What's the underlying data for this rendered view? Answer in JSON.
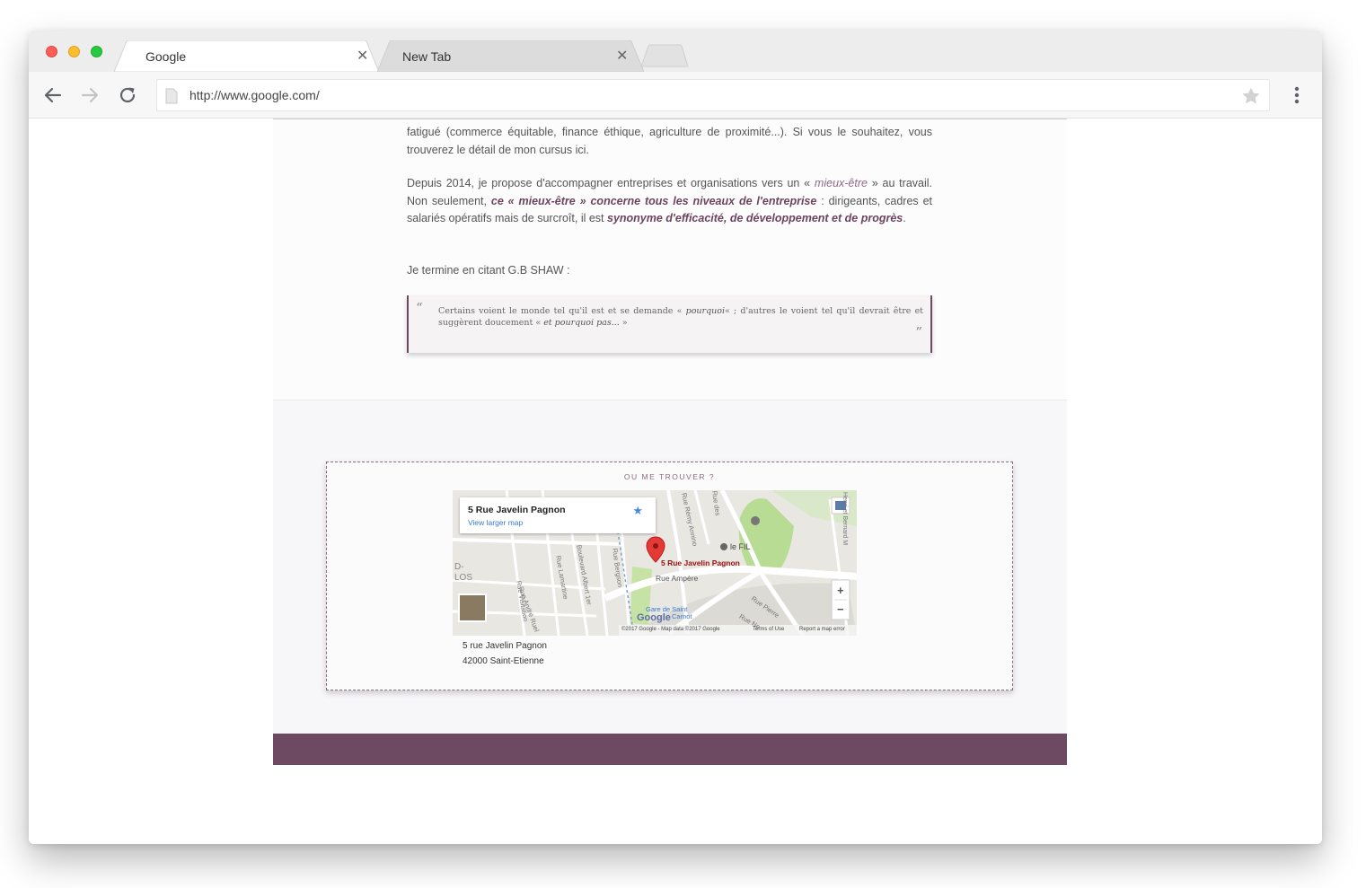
{
  "browser": {
    "tabs": [
      {
        "title": "Google",
        "active": true
      },
      {
        "title": "New Tab",
        "active": false
      }
    ],
    "close_glyph": "✕",
    "url": "http://www.google.com/",
    "icons": {
      "back": "arrow-left-icon",
      "forward": "arrow-right-icon",
      "reload": "reload-icon",
      "bookmark": "star-icon",
      "menu": "kebab-menu-icon"
    }
  },
  "article": {
    "p1": {
      "text": "fatigué (commerce équitable, finance éthique, agriculture de proximité...). Si vous le souhaitez, vous trouverez le détail de mon cursus ",
      "link": "ici",
      "end": "."
    },
    "p2": {
      "s1": "Depuis 2014, je propose d'accompagner entreprises et organisations vers un « ",
      "em1": "mieux-être",
      "s2": " » au travail. Non seulement, ",
      "em2": "ce « mieux-être » concerne tous les niveaux de l'entreprise",
      "s3": " : dirigeants, cadres et salariés opératifs mais de surcroît, il est ",
      "em3": "synonyme d'efficacité, de développement et de progrès",
      "s4": "."
    },
    "p3": "Je termine en citant G.B SHAW :",
    "quote": {
      "open_mark": "“",
      "close_mark": "”",
      "s1": "Certains voient le monde tel qu'il est et se demande « ",
      "em1": "pourquoi",
      "s2": "« ; d'autres le voient tel qu'il devrait être et suggèrent doucement « ",
      "em2": "et pourquoi pas...",
      "s3": " »"
    }
  },
  "location": {
    "heading": "OU ME TROUVER ?",
    "map": {
      "card_title": "5 Rue Javelin Pagnon",
      "card_link": "View larger map",
      "pin_label": "5 Rue Javelin Pagnon",
      "streets": [
        "Rue Ampère",
        "Rue Visitation",
        "Rue Lamartine",
        "Boulevard Albert 1er",
        "Rue Bergson",
        "Rue André Ruel",
        "Rue Rémy Annino",
        "Rue des",
        "Henri et Bernard M",
        "Rue Pierre",
        "Rue Ne"
      ],
      "places": [
        "le FIL",
        "Gare de Saint",
        "Carnot",
        "D-",
        "LOS"
      ],
      "logo": "Google",
      "footer_copyright": "©2017 Google - Map data ©2017 Google",
      "footer_terms": "Terms of Use",
      "footer_report": "Report a map error",
      "zoom_in": "+",
      "zoom_out": "−"
    },
    "address_line1": "5 rue Javelin Pagnon",
    "address_line2": "42000 Saint-Etienne"
  },
  "colors": {
    "accent": "#6d4962",
    "link": "#3a7bd5",
    "pin": "#e53935"
  }
}
